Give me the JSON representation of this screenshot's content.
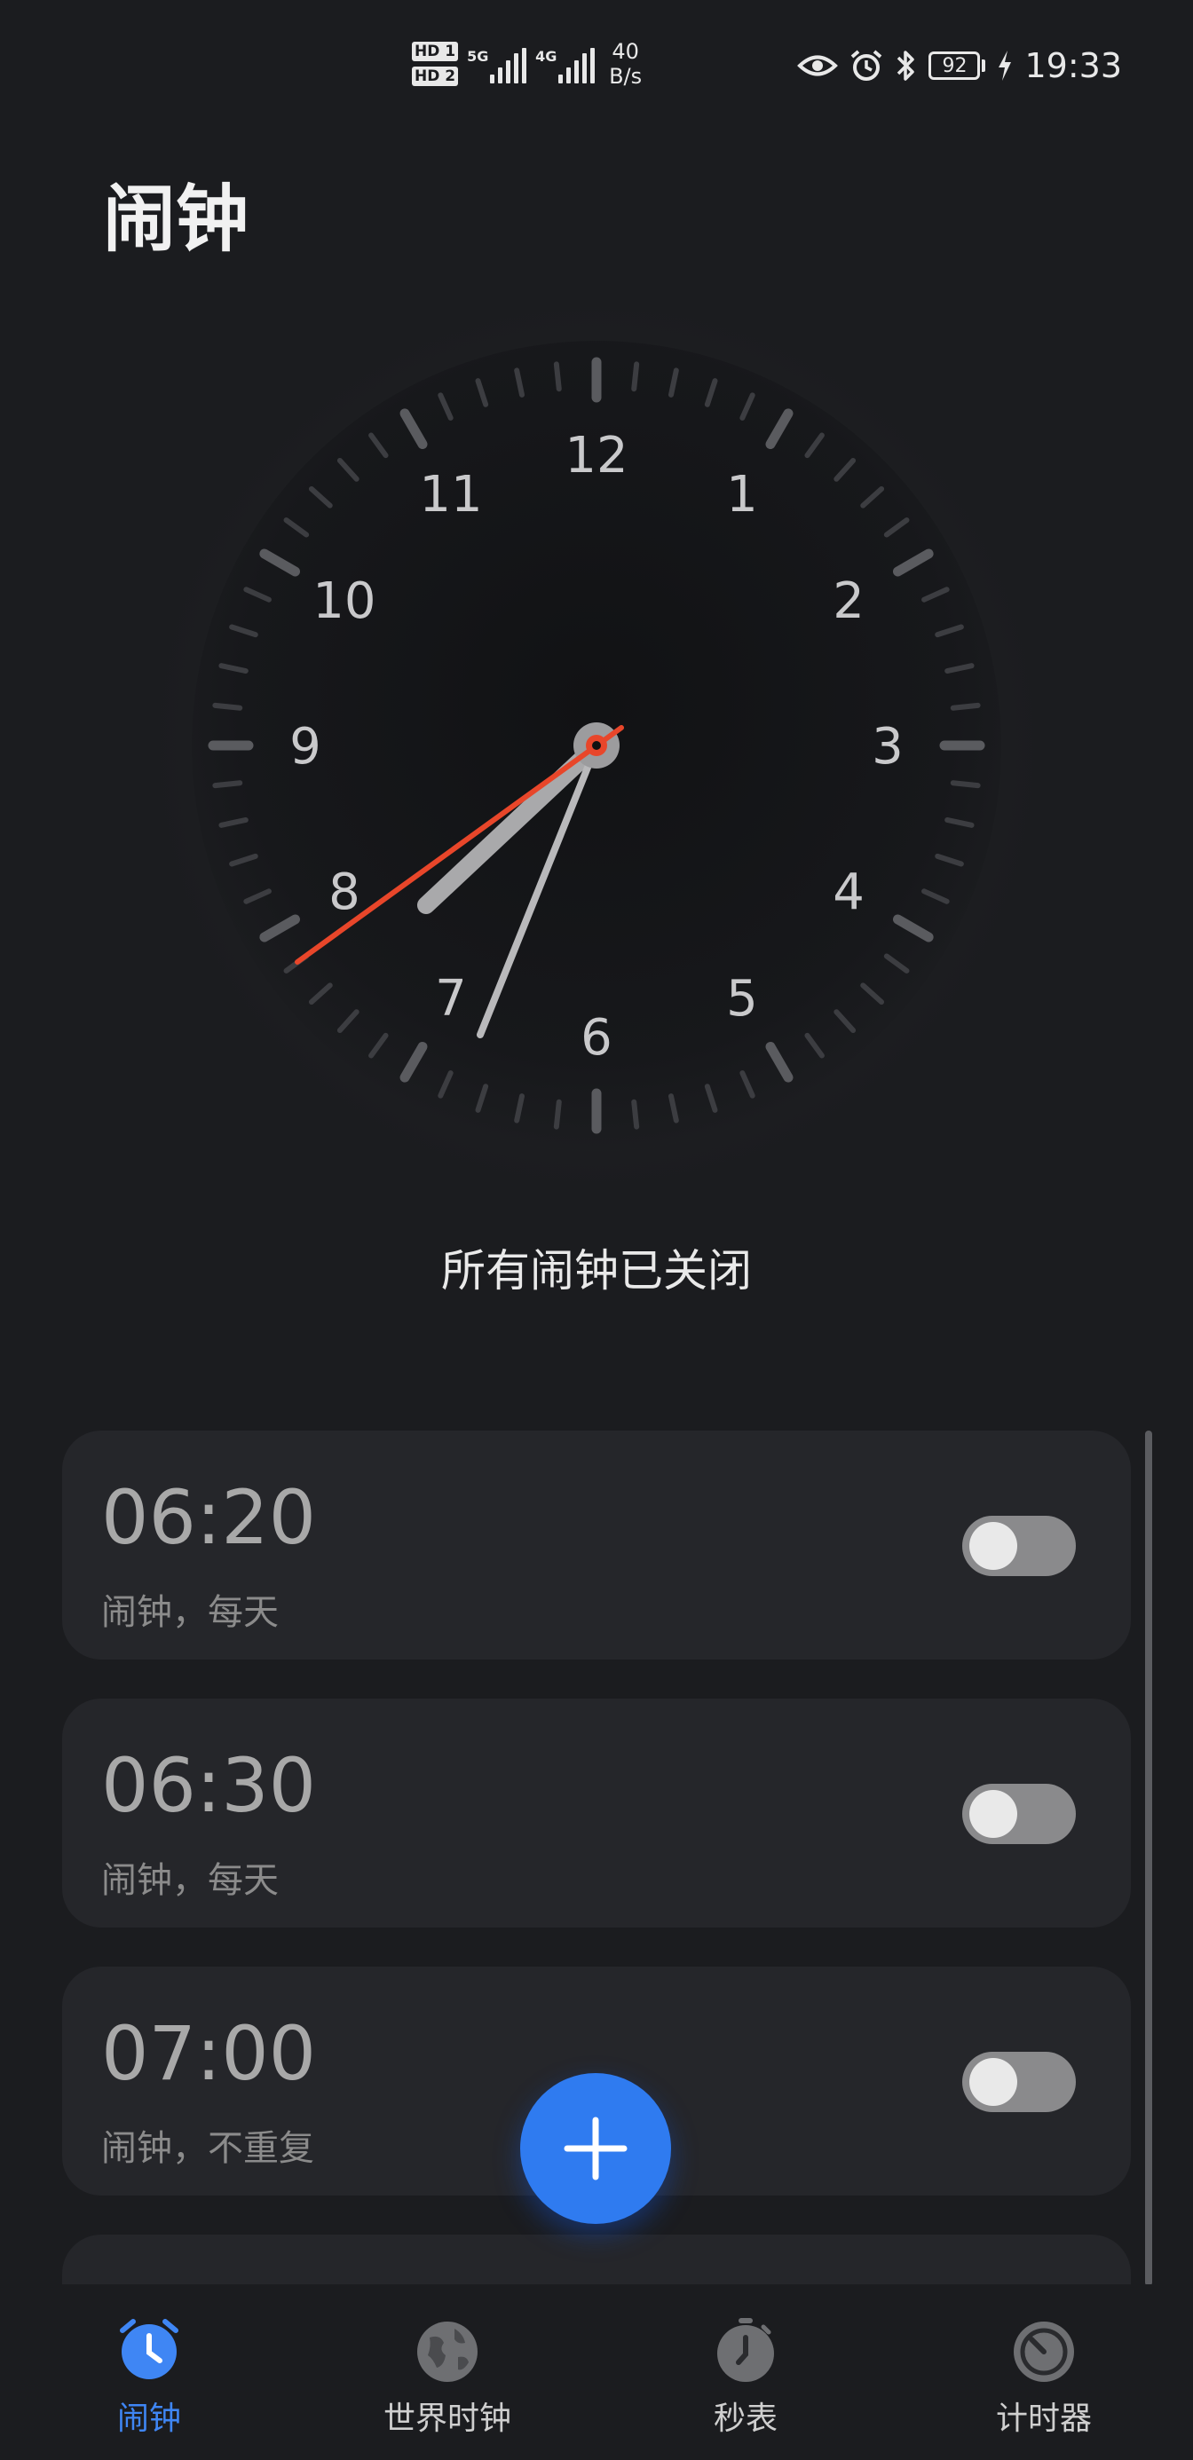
{
  "status_bar": {
    "sim1": "HD 1",
    "sim2": "HD 2",
    "network1": "5G",
    "network2": "4G",
    "net_speed_value": "40",
    "net_speed_unit": "B/s",
    "battery": "92",
    "time": "19:33"
  },
  "header": {
    "title": "闹钟"
  },
  "clock": {
    "numbers": [
      "12",
      "1",
      "2",
      "3",
      "4",
      "5",
      "6",
      "7",
      "8",
      "9",
      "10",
      "11"
    ],
    "second_hand_color": "#e8462a"
  },
  "status_text": "所有闹钟已关闭",
  "alarms": [
    {
      "time": "06:20",
      "label": "闹钟，每天",
      "enabled": false
    },
    {
      "time": "06:30",
      "label": "闹钟，每天",
      "enabled": false
    },
    {
      "time": "07:00",
      "label": "闹钟，不重复",
      "enabled": false
    }
  ],
  "bottom_nav": [
    {
      "label": "闹钟",
      "icon": "alarm-clock-icon",
      "active": true
    },
    {
      "label": "世界时钟",
      "icon": "globe-icon",
      "active": false
    },
    {
      "label": "秒表",
      "icon": "stopwatch-icon",
      "active": false
    },
    {
      "label": "计时器",
      "icon": "timer-icon",
      "active": false
    }
  ],
  "colors": {
    "accent": "#2f7bf0",
    "background": "#1b1c1f",
    "card": "#25262a"
  }
}
